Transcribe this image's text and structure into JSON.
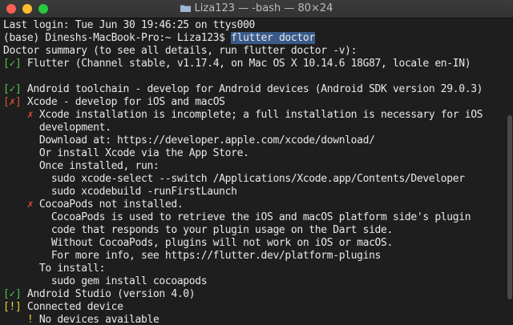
{
  "window": {
    "title": "Liza123 — -bash — 80×24"
  },
  "terminal": {
    "lines": [
      {
        "text": "Last login: Tue Jun 30 19:46:25 on ttys000"
      },
      {
        "prompt": "(base) Dineshs-MacBook-Pro:~ Liza123$ ",
        "command": "flutter doctor"
      },
      {
        "text": "Doctor summary (to see all details, run flutter doctor -v):"
      },
      {
        "mark": "[✓]",
        "text": " Flutter (Channel stable, v1.17.4, on Mac OS X 10.14.6 18G87, locale en-IN)"
      },
      {
        "text": ""
      },
      {
        "mark": "[✓]",
        "text": " Android toolchain - develop for Android devices (Android SDK version 29.0.3)"
      },
      {
        "mark": "[✗]",
        "text": " Xcode - develop for iOS and macOS"
      },
      {
        "indent": "    ",
        "mark": "✗",
        "text": " Xcode installation is incomplete; a full installation is necessary for iOS"
      },
      {
        "text": "      development."
      },
      {
        "text": "      Download at: https://developer.apple.com/xcode/download/"
      },
      {
        "text": "      Or install Xcode via the App Store."
      },
      {
        "text": "      Once installed, run:"
      },
      {
        "text": "        sudo xcode-select --switch /Applications/Xcode.app/Contents/Developer"
      },
      {
        "text": "        sudo xcodebuild -runFirstLaunch"
      },
      {
        "indent": "    ",
        "mark": "✗",
        "text": " CocoaPods not installed."
      },
      {
        "text": "        CocoaPods is used to retrieve the iOS and macOS platform side's plugin"
      },
      {
        "text": "        code that responds to your plugin usage on the Dart side."
      },
      {
        "text": "        Without CocoaPods, plugins will not work on iOS or macOS."
      },
      {
        "text": "        For more info, see https://flutter.dev/platform-plugins"
      },
      {
        "text": "      To install:"
      },
      {
        "text": "        sudo gem install cocoapods"
      },
      {
        "mark": "[✓]",
        "text": " Android Studio (version 4.0)"
      },
      {
        "mark": "[!]",
        "text": " Connected device"
      },
      {
        "indent": "    ",
        "mark": "!",
        "text": " No devices available"
      }
    ]
  },
  "colors": {
    "success": "#4ec44e",
    "error": "#e0503c",
    "warning": "#e8d23c",
    "selection": "#3a5a8a"
  }
}
